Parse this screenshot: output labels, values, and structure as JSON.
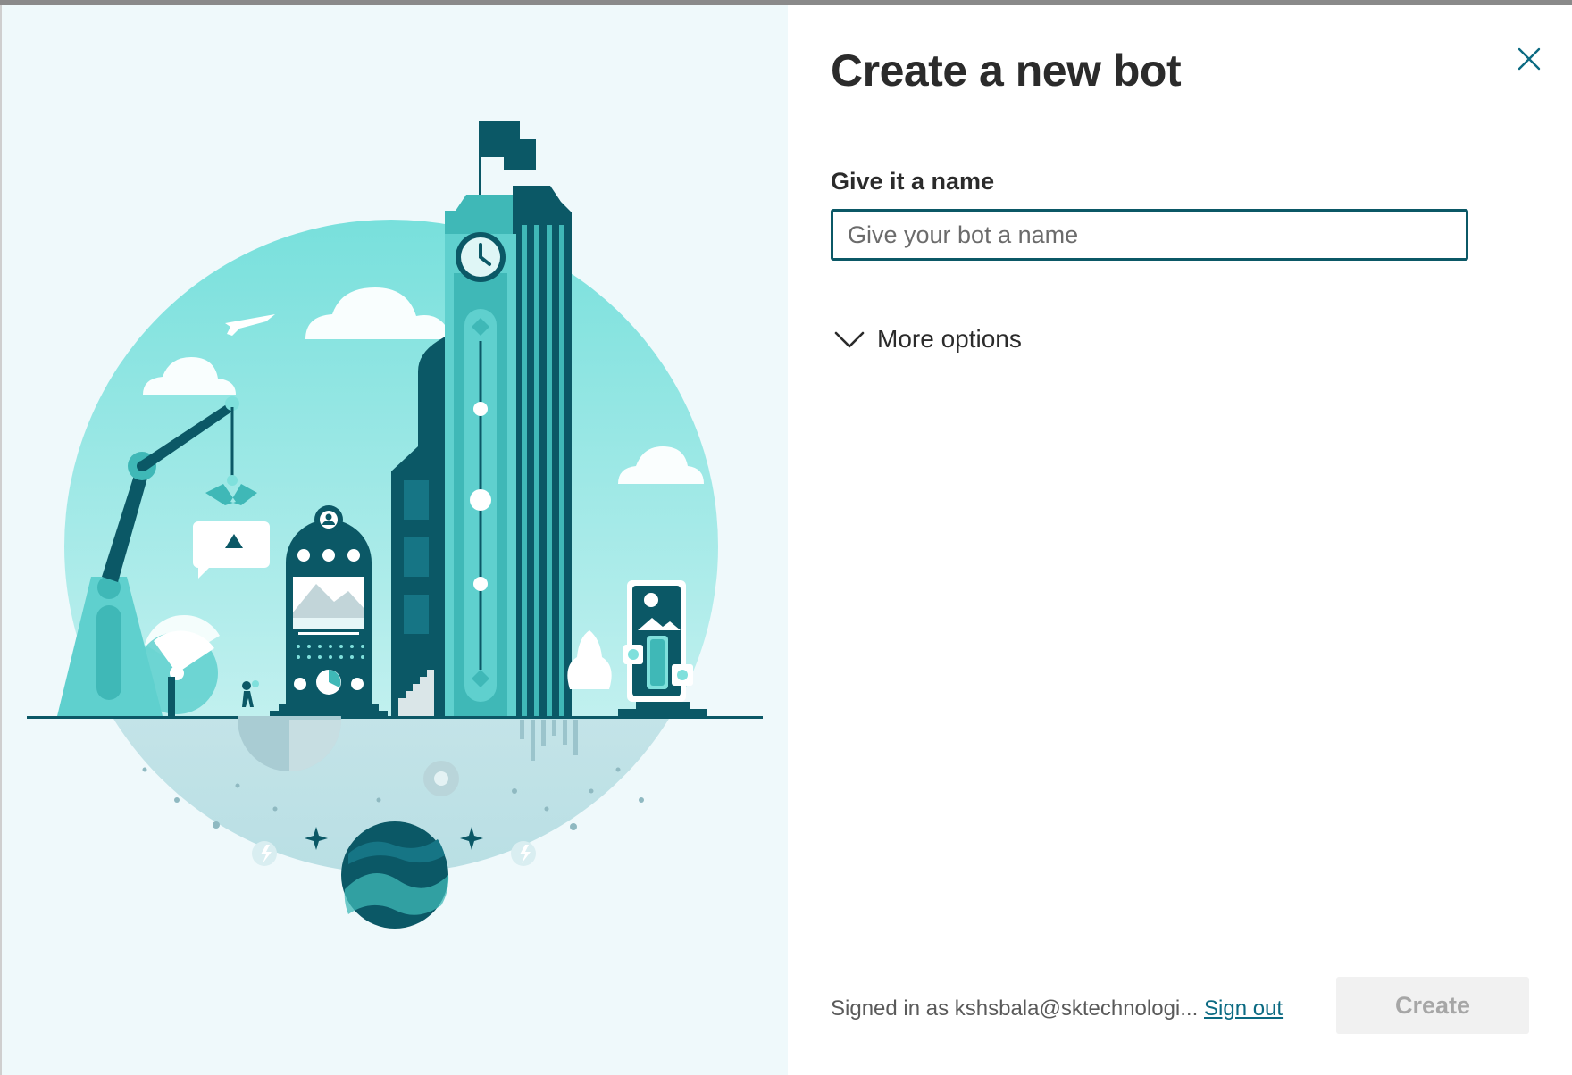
{
  "dialog": {
    "title": "Create a new bot",
    "close_icon": "close-icon"
  },
  "form": {
    "name_label": "Give it a name",
    "name_placeholder": "Give your bot a name",
    "name_value": "",
    "more_options_label": "More options",
    "more_options_icon": "chevron-down-icon"
  },
  "footer": {
    "signed_in_text": "Signed in as kshsbala@sktechnologi...",
    "sign_out_label": "Sign out",
    "create_label": "Create"
  },
  "illustration": {
    "description_icon": "city-globe-illustration",
    "colors": {
      "background": "#eff9fb",
      "globe": "#7fe0dc",
      "teal_dark": "#0b5866",
      "teal_mid": "#3fb8b7",
      "teal_light": "#6fd8d6"
    }
  }
}
